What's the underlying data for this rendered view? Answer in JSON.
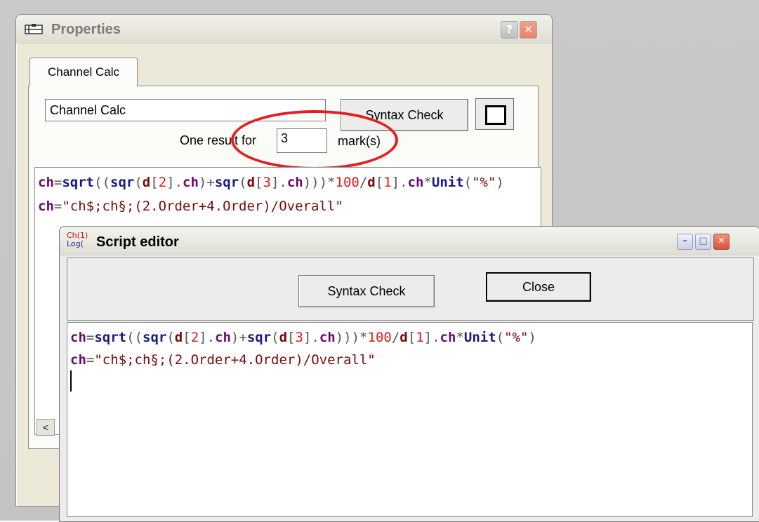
{
  "properties": {
    "title": "Properties",
    "help_label": "?",
    "close_label": "✕",
    "tab_label": "Channel Calc",
    "name_value": "Channel Calc",
    "syntax_check_label": "Syntax Check",
    "result_label": "One result for",
    "count_value": "3",
    "mark_label": "mark(s)",
    "scroll_left": "<"
  },
  "script_editor": {
    "title": "Script editor",
    "icon_line1": "Ch(1)",
    "icon_line2": "Log(",
    "syntax_check_label": "Syntax Check",
    "close_label": "Close",
    "min_label": "–",
    "max_label": "□",
    "close_ctrl_label": "✕"
  },
  "code": {
    "line1_tokens": [
      {
        "t": "ch",
        "c": "k-ch"
      },
      {
        "t": "=",
        "c": "k-op"
      },
      {
        "t": "sqrt",
        "c": "k-fn"
      },
      {
        "t": "((",
        "c": "k-op"
      },
      {
        "t": "sqr",
        "c": "k-fn"
      },
      {
        "t": "(",
        "c": "k-op"
      },
      {
        "t": "d",
        "c": "k-d"
      },
      {
        "t": "[",
        "c": "k-op"
      },
      {
        "t": "2",
        "c": "k-num"
      },
      {
        "t": "].",
        "c": "k-op"
      },
      {
        "t": "ch",
        "c": "k-ch"
      },
      {
        "t": ")+",
        "c": "k-op"
      },
      {
        "t": "sqr",
        "c": "k-fn"
      },
      {
        "t": "(",
        "c": "k-op"
      },
      {
        "t": "d",
        "c": "k-d"
      },
      {
        "t": "[",
        "c": "k-op"
      },
      {
        "t": "3",
        "c": "k-num"
      },
      {
        "t": "].",
        "c": "k-op"
      },
      {
        "t": "ch",
        "c": "k-ch"
      },
      {
        "t": ")))*",
        "c": "k-op"
      },
      {
        "t": "100",
        "c": "k-num"
      },
      {
        "t": "/",
        "c": "k-op"
      },
      {
        "t": "d",
        "c": "k-d"
      },
      {
        "t": "[",
        "c": "k-op"
      },
      {
        "t": "1",
        "c": "k-num"
      },
      {
        "t": "].",
        "c": "k-op"
      },
      {
        "t": "ch",
        "c": "k-ch"
      },
      {
        "t": "*",
        "c": "k-op"
      },
      {
        "t": "Unit",
        "c": "k-unit"
      },
      {
        "t": "(",
        "c": "k-op"
      },
      {
        "t": "\"%\"",
        "c": "k-str"
      },
      {
        "t": ")",
        "c": "k-op"
      }
    ],
    "line2_tokens": [
      {
        "t": "ch",
        "c": "k-ch"
      },
      {
        "t": "=",
        "c": "k-op"
      },
      {
        "t": "\"ch$;ch§;(2.Order+4.Order)/Overall\"",
        "c": "k-str"
      }
    ]
  }
}
